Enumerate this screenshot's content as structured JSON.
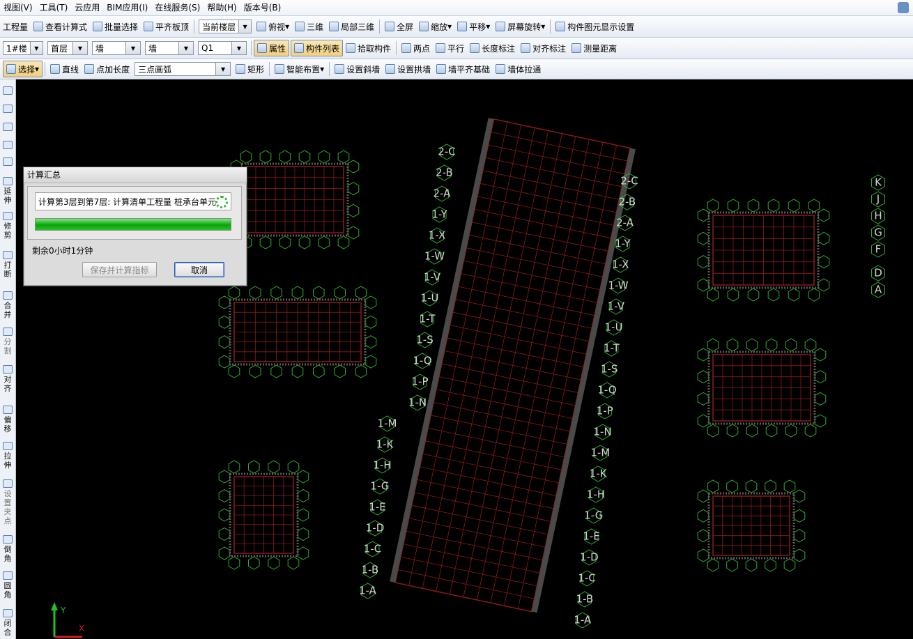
{
  "menu": {
    "items": [
      "视图(V)",
      "工具(T)",
      "云应用",
      "BIM应用(I)",
      "在线服务(S)",
      "帮助(H)",
      "版本号(B)"
    ]
  },
  "toolbar1": {
    "items": [
      "工程量",
      "查看计算式",
      "批量选择",
      "平齐板顶"
    ],
    "floor_combo": "当前楼层",
    "view_items": [
      "俯视",
      "三维",
      "局部三维",
      "全屏",
      "缩放",
      "平移",
      "屏幕旋转",
      "构件图元显示设置"
    ]
  },
  "toolbar2": {
    "building": "1#楼",
    "floor": "首层",
    "type": "墙",
    "subtype": "墙",
    "component": "Q1",
    "buttons": [
      "属性",
      "构件列表",
      "拾取构件",
      "两点",
      "平行",
      "长度标注",
      "对齐标注",
      "测量距离"
    ]
  },
  "toolbar3": {
    "select": "选择",
    "buttons": [
      "直线",
      "点加长度",
      "三点画弧"
    ],
    "buttons2": [
      "矩形",
      "智能布置",
      "设置斜墙",
      "设置拱墙",
      "墙平齐基础",
      "墙体拉通"
    ]
  },
  "leftbar": {
    "tools": [
      "延伸",
      "修剪",
      "打断",
      "合并",
      "分割",
      "对齐",
      "偏移",
      "拉伸",
      "设置夹点",
      "倒角",
      "圆角",
      "闭合"
    ]
  },
  "dialog": {
    "title": "计算汇总",
    "status": "计算第3层到第7层: 计算清单工程量 桩承台单元",
    "progress": 100,
    "remaining": "剩余0小时1分钟",
    "save_button": "保存并计算指标",
    "cancel_button": "取消"
  },
  "cad": {
    "grid_color": "#8b1a1a",
    "axis_color": "#2eae2e",
    "axis_labels_center": [
      "2-C",
      "2-B",
      "2-A",
      "1-Y",
      "1-X",
      "1-W",
      "1-V",
      "1-U",
      "1-T",
      "1-S",
      "1-Q",
      "1-P",
      "1-N",
      "1-M",
      "1-K",
      "1-H",
      "1-G",
      "1-E",
      "1-D",
      "1-C",
      "1-B",
      "1-A"
    ],
    "axis_labels_right": [
      "K",
      "J",
      "H",
      "G",
      "F",
      "D",
      "A"
    ],
    "axis_y": "Y",
    "axis_x": "X"
  }
}
